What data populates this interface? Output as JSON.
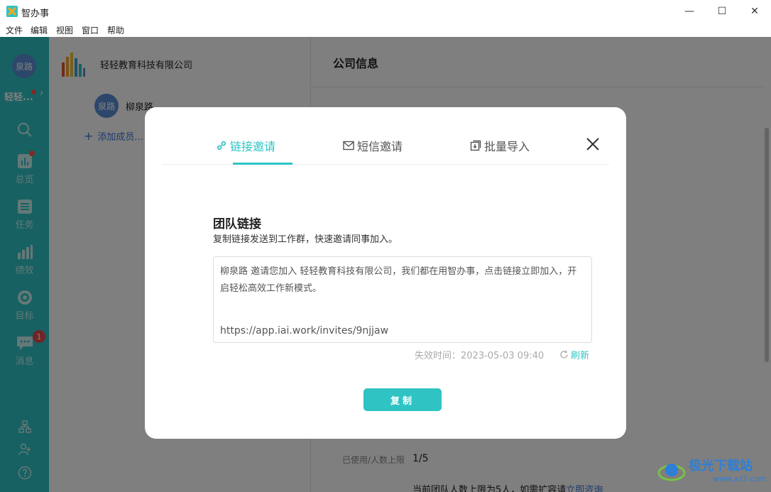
{
  "window": {
    "title": "智办事",
    "min_glyph": "—",
    "max_glyph": "☐",
    "close_glyph": "✕"
  },
  "menu": [
    "文件",
    "编辑",
    "视图",
    "窗口",
    "帮助"
  ],
  "sidebar": {
    "avatar_text": "泉路",
    "team_name": "轻轻...",
    "chevron": "›",
    "items": [
      {
        "label": "",
        "icon": "search-icon"
      },
      {
        "label": "总览",
        "icon": "overview-icon"
      },
      {
        "label": "任务",
        "icon": "task-icon"
      },
      {
        "label": "绩效",
        "icon": "performance-icon"
      },
      {
        "label": "目标",
        "icon": "target-icon"
      },
      {
        "label": "消息",
        "icon": "message-icon"
      }
    ],
    "message_badge": "1",
    "bottom_icons": [
      "org-chart-icon",
      "add-person-icon",
      "help-icon"
    ]
  },
  "middle": {
    "company_name": "轻轻教育科技有限公司",
    "member_avatar": "泉路",
    "member_name": "柳泉路",
    "add_member": "添加成员...",
    "add_plus": "+"
  },
  "right": {
    "title": "公司信息",
    "usage_label": "已使用/人数上限",
    "usage_value": "1/5",
    "limit_text": "当前团队人数上限为5人，如需扩容请",
    "limit_link": "立即咨询"
  },
  "dialog": {
    "tabs": [
      {
        "label": "链接邀请",
        "icon": "link-icon",
        "active": true
      },
      {
        "label": "短信邀请",
        "icon": "mail-icon",
        "active": false
      },
      {
        "label": "批量导入",
        "icon": "import-icon",
        "active": false
      }
    ],
    "section_title": "团队链接",
    "section_desc": "复制链接发送到工作群，快速邀请同事加入。",
    "invite_text": "柳泉路 邀请您加入 轻轻教育科技有限公司，我们都在用智办事，点击链接立即加入，开启轻松高效工作新模式。",
    "invite_url": "https://app.iai.work/invites/9njjaw",
    "expire_label": "失效时间：2023-05-03 09:40",
    "refresh_label": "刷新",
    "copy_button": "复制"
  },
  "watermark": {
    "text": "极光下载站",
    "sub": "www.xz7.com"
  },
  "colors": {
    "accent": "#2fc3c4",
    "link": "#3a76d6",
    "badge": "#e5484d"
  }
}
